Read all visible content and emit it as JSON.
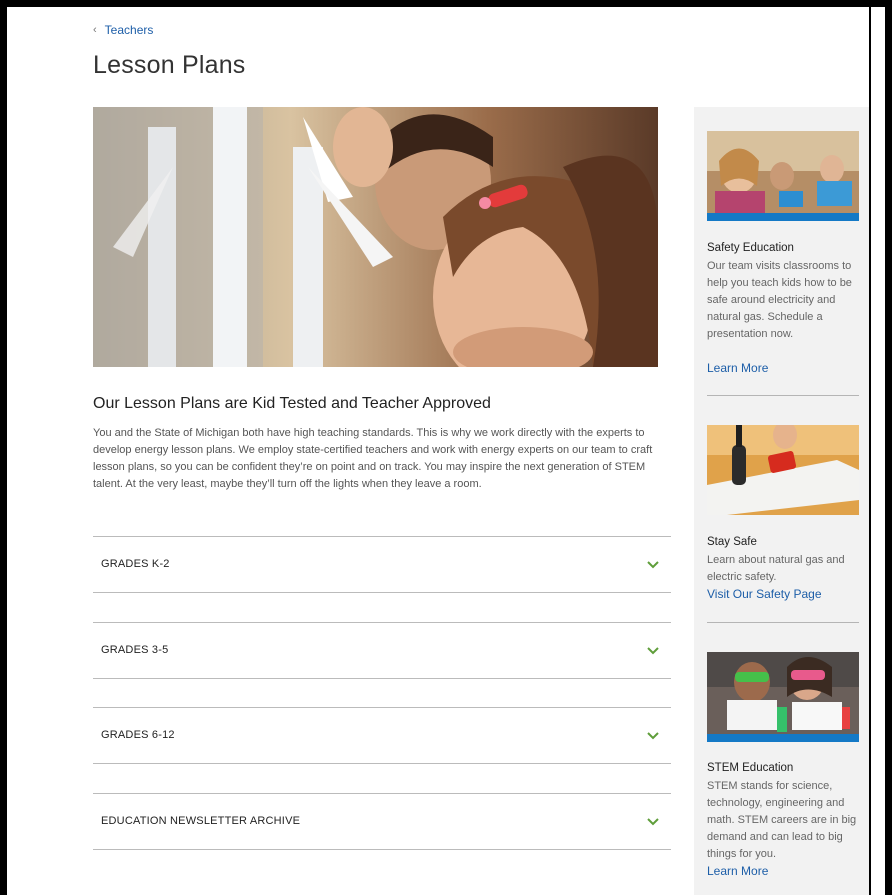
{
  "breadcrumb": {
    "label": "Teachers"
  },
  "page": {
    "title": "Lesson Plans"
  },
  "hero": {
    "icon": "children-building-windmills-photo"
  },
  "intro": {
    "heading": "Our Lesson Plans are Kid Tested and Teacher Approved",
    "body": "You and the State of Michigan both have high teaching standards. This is why we work directly with the experts to develop energy lesson plans. We employ state-certified teachers and work with energy experts on our team to craft lesson plans, so you can be confident they’re on point and on track. You may inspire the next generation of STEM talent. At the very least, maybe they’ll turn off the lights when they leave a room."
  },
  "accordion": [
    {
      "label": "GRADES K-2"
    },
    {
      "label": "GRADES 3-5"
    },
    {
      "label": "GRADES 6-12"
    },
    {
      "label": "EDUCATION NEWSLETTER ARCHIVE"
    }
  ],
  "sidebar": {
    "cards": [
      {
        "title": "Safety Education",
        "text": "Our team visits classrooms to help you teach kids how to be safe around electricity and natural gas. Schedule a presentation now.",
        "link": "Learn More"
      },
      {
        "title": "Stay Safe",
        "text": "Learn about natural gas and electric safety.",
        "link": "Visit Our Safety Page"
      },
      {
        "title": "STEM Education",
        "text": "STEM stands for science, technology, engineering and math. STEM careers are in big demand and can lead to big things for you.",
        "link": "Learn More"
      }
    ]
  },
  "colors": {
    "accent_link": "#1d5ea8",
    "chevron": "#5f9e3a",
    "card_bar": "#1479c6"
  }
}
